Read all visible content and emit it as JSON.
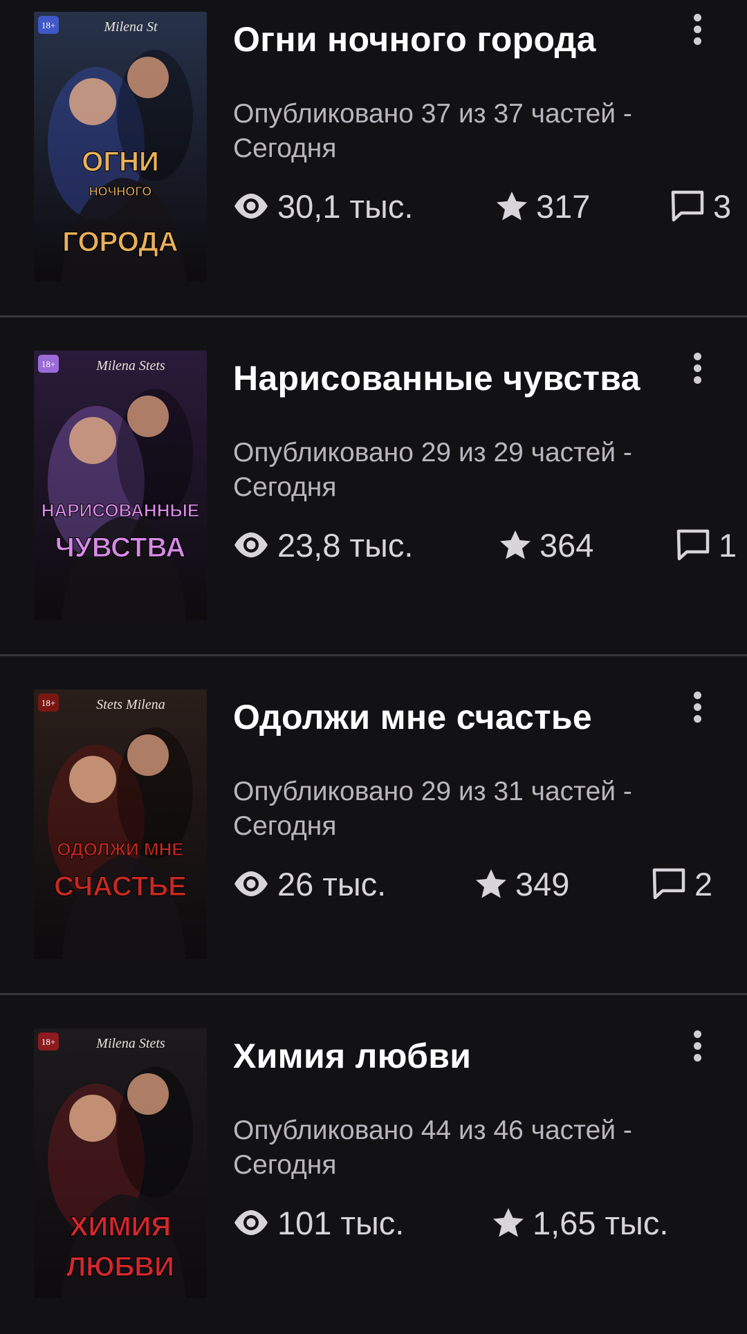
{
  "stories": [
    {
      "title": "Огни ночного города",
      "published": "Опубликовано 37 из 37 частей - Сегодня",
      "views": "30,1 тыс.",
      "votes": "317",
      "comments": "3",
      "cover": {
        "author": "Milena St",
        "age": "18+",
        "line1": "ОГНИ",
        "line2": "НОЧНОГО",
        "line3": "ГОРОДА",
        "bg": "#27324a",
        "accent": "#e9b15a",
        "accent2": "#3f57c8"
      }
    },
    {
      "title": "Нарисованные чувства",
      "published": "Опубликовано 29 из 29 частей - Сегодня",
      "views": "23,8 тыс.",
      "votes": "364",
      "comments": "1",
      "cover": {
        "author": "Milena Stets",
        "age": "18+",
        "line1": "НАРИСОВАННЫЕ",
        "line2": "ЧУВСТВА",
        "line3": "",
        "bg": "#2b1b3a",
        "accent": "#d98ae8",
        "accent2": "#9a6ad8"
      }
    },
    {
      "title": "Одолжи мне счастье",
      "published": "Опубликовано 29 из 31 частей - Сегодня",
      "views": "26 тыс.",
      "votes": "349",
      "comments": "2",
      "cover": {
        "author": "Stets Milena",
        "age": "18+",
        "line1": "ОДОЛЖИ МНЕ",
        "line2": "СЧАСТЬЕ",
        "line3": "",
        "bg": "#2a1e1a",
        "accent": "#c42a22",
        "accent2": "#7a1612"
      }
    },
    {
      "title": "Химия любви",
      "published": "Опубликовано 44 из 46 частей - Сегодня",
      "views": "101 тыс.",
      "votes": "1,65 тыс.",
      "comments": "",
      "cover": {
        "author": "Milena Stets",
        "age": "18+",
        "line1": "ХИМИЯ",
        "line2": "ЛЮБВИ",
        "line3": "",
        "bg": "#1c1a1d",
        "accent": "#d2282e",
        "accent2": "#8c1a1f"
      }
    }
  ],
  "icons": {
    "views": "eye-icon",
    "votes": "star-icon",
    "comments": "comment-icon",
    "menu": "more-vertical-icon"
  },
  "colors": {
    "background": "#121114",
    "divider": "#38363b",
    "title": "#ffffff",
    "meta": "#b9b7bd",
    "stats": "#d7d5da"
  }
}
